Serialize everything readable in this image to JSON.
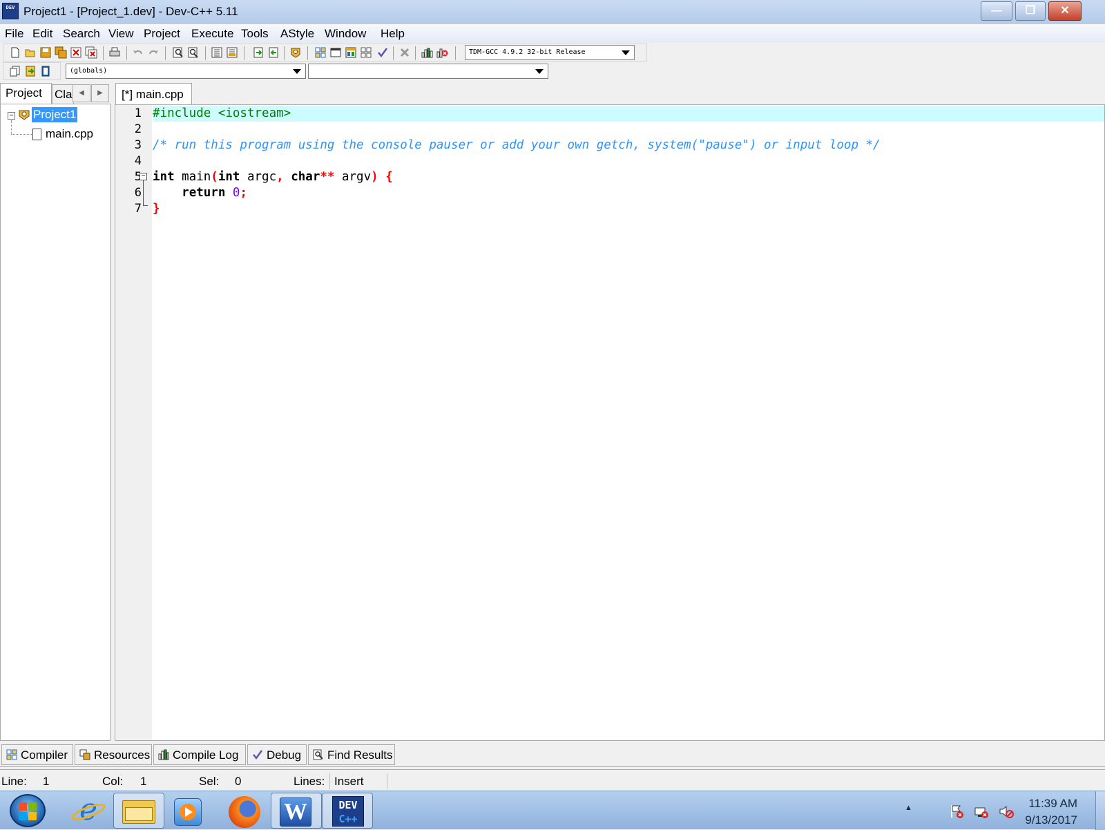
{
  "window": {
    "app_icon_text": "DEV",
    "title": "Project1 - [Project_1.dev] - Dev-C++ 5.11",
    "minimize_glyph": "—",
    "restore_glyph": "❐",
    "close_glyph": "✕"
  },
  "menu": [
    "File",
    "Edit",
    "Search",
    "View",
    "Project",
    "Execute",
    "Tools",
    "AStyle",
    "Window",
    "Help"
  ],
  "toolbar": {
    "compiler_select": "TDM-GCC 4.9.2 32-bit Release",
    "scope_select": "(globals)",
    "member_select": ""
  },
  "left_panel": {
    "tabs": [
      "Project",
      "Cla"
    ],
    "scroll_left": "◀",
    "scroll_right": "▶",
    "expander": "−",
    "tree": {
      "project": "Project1",
      "files": [
        "main.cpp"
      ]
    }
  },
  "editor": {
    "tab_label": "[*] main.cpp",
    "fold_glyph": "−",
    "line_numbers": [
      "1",
      "2",
      "3",
      "4",
      "5",
      "6",
      "7"
    ],
    "lines": {
      "l1": "#include <iostream>",
      "l3": "/* run this program using the console pauser or add your own getch, system(\"pause\") or input loop */",
      "l5_int": "int",
      "l5_main": " main",
      "l5_lp": "(",
      "l5_int2": "int",
      "l5_argc": " argc",
      "l5_comma": ",",
      "l5_char": " char",
      "l5_stars": "**",
      "l5_argv": " argv",
      "l5_rp": ")",
      "l5_brace": " {",
      "l6_indent": "    ",
      "l6_return": "return",
      "l6_num": " 0",
      "l6_semi": ";",
      "l7_brace": "}"
    }
  },
  "bottom_tabs": [
    "Compiler",
    "Resources",
    "Compile Log",
    "Debug",
    "Find Results"
  ],
  "status": {
    "line_label": "Line:",
    "line_value": "1",
    "col_label": "Col:",
    "col_value": "1",
    "sel_label": "Sel:",
    "sel_value": "0",
    "lines_label": "Lines:",
    "lines_value": "",
    "mode": "Insert"
  },
  "taskbar": {
    "devcpp_line1": "DEV",
    "devcpp_line2": "C++",
    "word_letter": "W",
    "ie_letter": "e",
    "tray_arrow": "▲",
    "time": "11:39 AM",
    "date": "9/13/2017"
  },
  "colors": {
    "current_line": "#ccfcff",
    "preprocessor": "#008000",
    "comment": "#2b95ff",
    "symbol": "#ff0000",
    "number": "#8000ff",
    "selection": "#3399ff"
  }
}
